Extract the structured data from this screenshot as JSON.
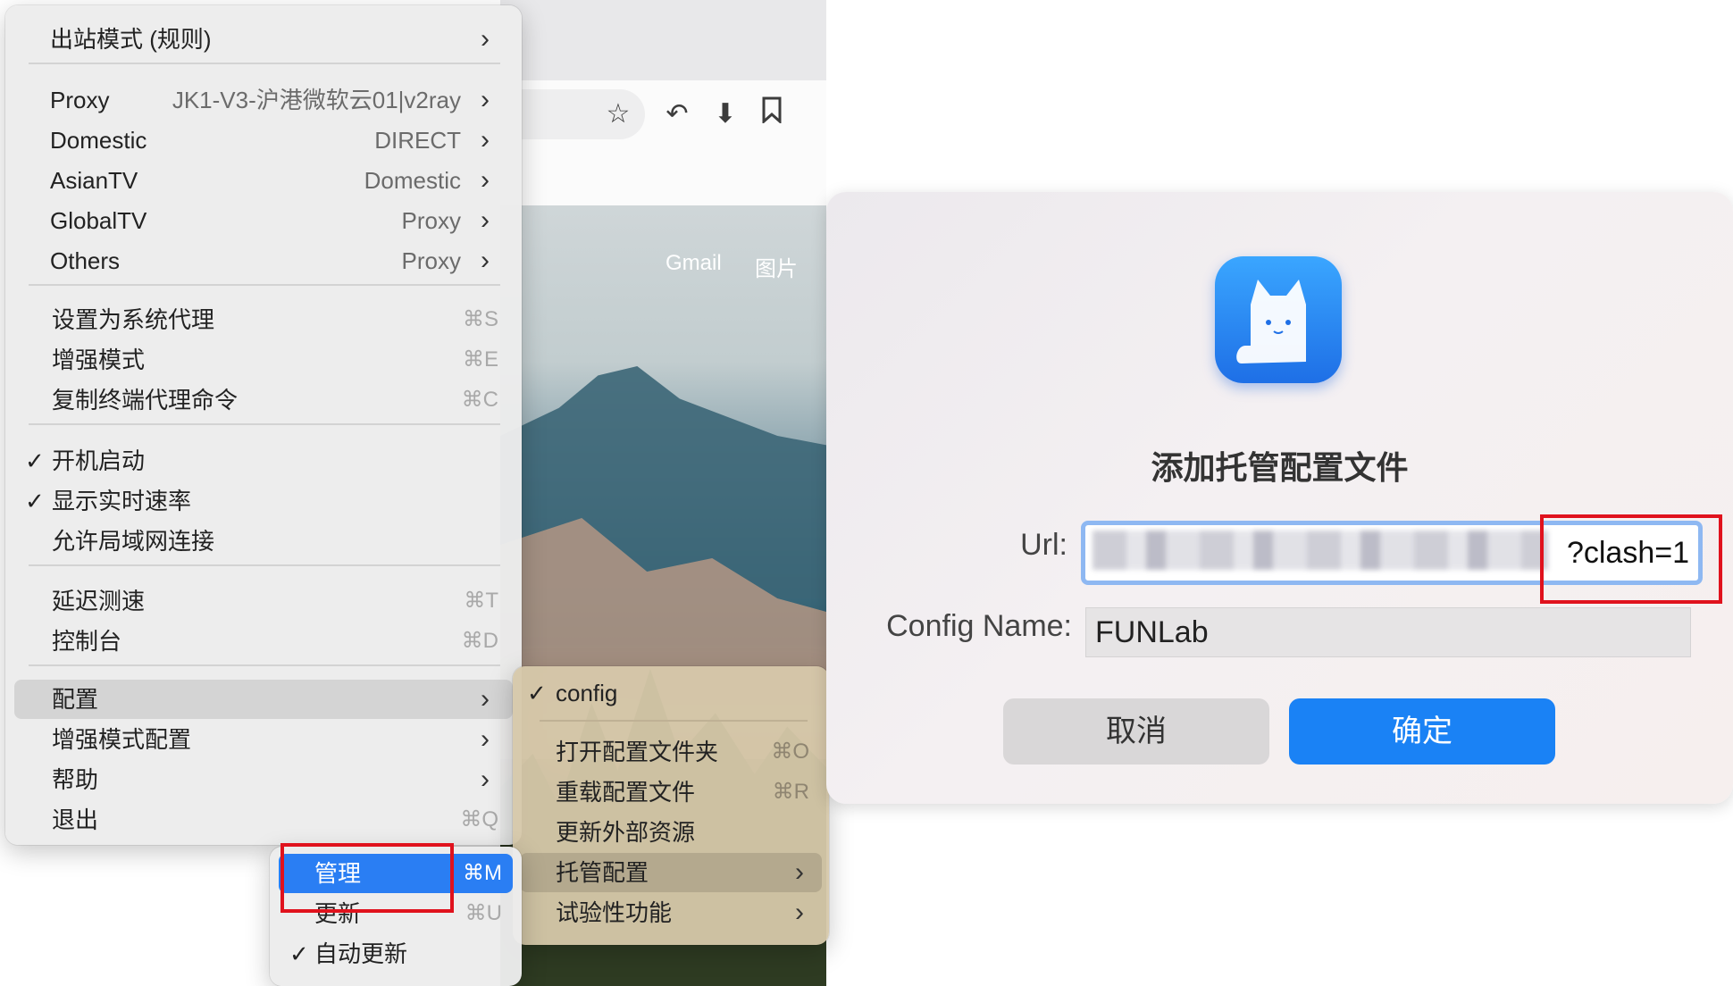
{
  "browser": {
    "gmail_link": "Gmail",
    "images_link": "图片",
    "icons": [
      "star-icon",
      "reply-icon",
      "download-icon",
      "bookmark-icon"
    ]
  },
  "main_menu": {
    "outbound_mode": "出站模式 (规则)",
    "proxy_groups": [
      {
        "label": "Proxy",
        "value": "JK1-V3-沪港微软云01|v2ray"
      },
      {
        "label": "Domestic",
        "value": "DIRECT"
      },
      {
        "label": "AsianTV",
        "value": "Domestic"
      },
      {
        "label": "GlobalTV",
        "value": "Proxy"
      },
      {
        "label": "Others",
        "value": "Proxy"
      }
    ],
    "system_items": [
      {
        "label": "设置为系统代理",
        "shortcut": "⌘S"
      },
      {
        "label": "增强模式",
        "shortcut": "⌘E"
      },
      {
        "label": "复制终端代理命令",
        "shortcut": "⌘C"
      }
    ],
    "toggle_items": [
      {
        "label": "开机启动",
        "checked": true
      },
      {
        "label": "显示实时速率",
        "checked": true
      },
      {
        "label": "允许局域网连接",
        "checked": false
      }
    ],
    "tool_items": [
      {
        "label": "延迟测速",
        "shortcut": "⌘T"
      },
      {
        "label": "控制台",
        "shortcut": "⌘D"
      }
    ],
    "config": "配置",
    "enhanced_config": "增强模式配置",
    "help": "帮助",
    "quit": {
      "label": "退出",
      "shortcut": "⌘Q"
    },
    "check_glyph": "✓",
    "chevron_glyph": "›"
  },
  "config_submenu": {
    "current": "config",
    "open_folder": {
      "label": "打开配置文件夹",
      "shortcut": "⌘O"
    },
    "reload": {
      "label": "重载配置文件",
      "shortcut": "⌘R"
    },
    "update_external": "更新外部资源",
    "hosted": "托管配置",
    "experimental": "试验性功能"
  },
  "hosted_submenu": {
    "manage": {
      "label": "管理",
      "shortcut": "⌘M"
    },
    "update": {
      "label": "更新",
      "shortcut": "⌘U"
    },
    "auto_update": {
      "label": "自动更新",
      "checked": true
    }
  },
  "dialog": {
    "title": "添加托管配置文件",
    "url_label": "Url:",
    "url_visible_suffix": "?clash=1",
    "config_name_label": "Config Name:",
    "config_name_value": "FUNLab",
    "cancel": "取消",
    "ok": "确定"
  },
  "colors": {
    "accent_blue": "#1a82f5",
    "highlight_red": "#e0121d"
  }
}
